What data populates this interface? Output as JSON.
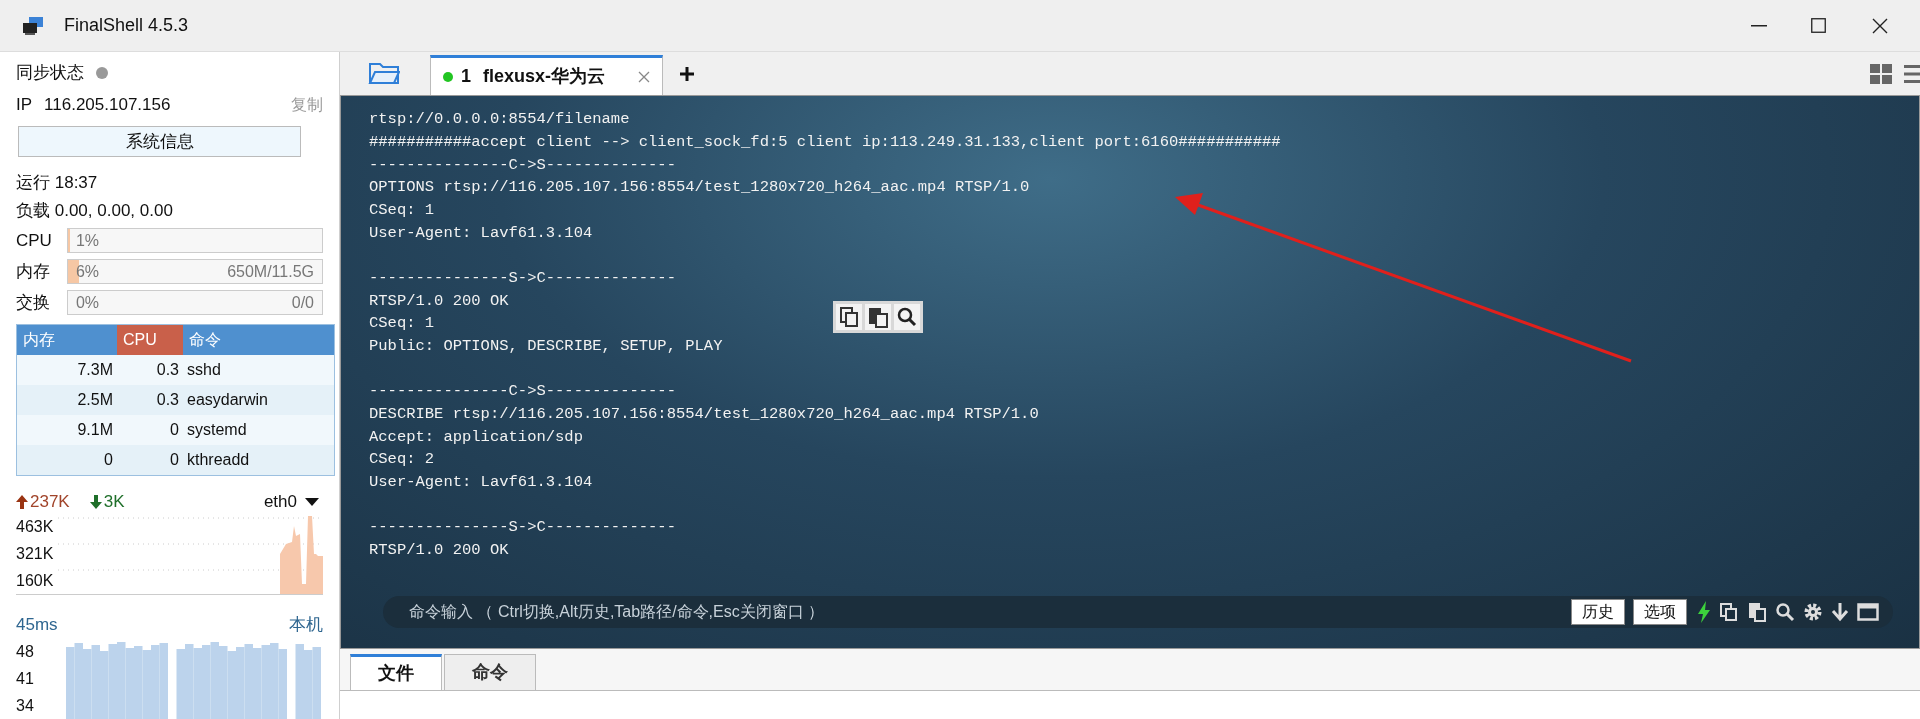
{
  "window": {
    "title": "FinalShell 4.5.3"
  },
  "sidebar": {
    "sync": {
      "label": "同步状态",
      "synced": false
    },
    "ip": {
      "label": "IP",
      "value": "116.205.107.156",
      "copy": "复制"
    },
    "sysinfo_button": "系统信息",
    "uptime": "运行 18:37",
    "load": "负载 0.00, 0.00, 0.00",
    "meters": [
      {
        "label": "CPU",
        "level": 0.01,
        "percent": "1%"
      },
      {
        "label": "内存",
        "level": 0.045,
        "percent": "6%",
        "detail": "650M/11.5G"
      },
      {
        "label": "交换",
        "level": 0,
        "percent": "0%",
        "detail": "0/0"
      }
    ],
    "processes": {
      "columns": [
        {
          "label": "内存",
          "selected": false
        },
        {
          "label": "CPU",
          "selected": true
        },
        {
          "label": "命令",
          "selected": false
        }
      ],
      "rows": [
        [
          "7.3M",
          "0.3",
          "sshd"
        ],
        [
          "2.5M",
          "0.3",
          "easydarwin"
        ],
        [
          "9.1M",
          "0",
          "systemd"
        ],
        [
          "0",
          "0",
          "kthreadd"
        ]
      ]
    },
    "network": {
      "upload": "237K",
      "download": "3K",
      "interface": "eth0",
      "axis_labels": [
        "463K",
        "321K",
        "160K"
      ]
    },
    "ping": {
      "latency": "45ms",
      "host": "本机",
      "axis_labels": [
        "48",
        "41",
        "34"
      ]
    }
  },
  "tabs": [
    {
      "number": "1",
      "label": "flexusx-华为云",
      "connected": true,
      "selected": true
    }
  ],
  "terminal": {
    "blocks": [
      [
        "rtsp://0.0.0.0:8554/filename",
        "###########accept client --> client_sock_fd:5 client ip:113.249.31.133,client port:6160###########",
        "---------------C->S--------------",
        "OPTIONS rtsp://116.205.107.156:8554/test_1280x720_h264_aac.mp4 RTSP/1.0",
        "CSeq: 1",
        "User-Agent: Lavf61.3.104"
      ],
      [
        "---------------S->C--------------",
        "RTSP/1.0 200 OK",
        "CSeq: 1",
        "Public: OPTIONS, DESCRIBE, SETUP, PLAY"
      ],
      [
        "---------------C->S--------------",
        "DESCRIBE rtsp://116.205.107.156:8554/test_1280x720_h264_aac.mp4 RTSP/1.0",
        "Accept: application/sdp",
        "CSeq: 2",
        "User-Agent: Lavf61.3.104"
      ],
      [
        "---------------S->C--------------",
        "RTSP/1.0 200 OK"
      ]
    ]
  },
  "command_bar": {
    "placeholder": "命令输入 （ Ctrl切换,Alt历史,Tab路径/命令,Esc关闭窗口 ）",
    "buttons": [
      "历史",
      "选项"
    ]
  },
  "bottom_tabs": [
    {
      "label": "文件",
      "selected": true
    },
    {
      "label": "命令",
      "selected": false
    }
  ]
}
